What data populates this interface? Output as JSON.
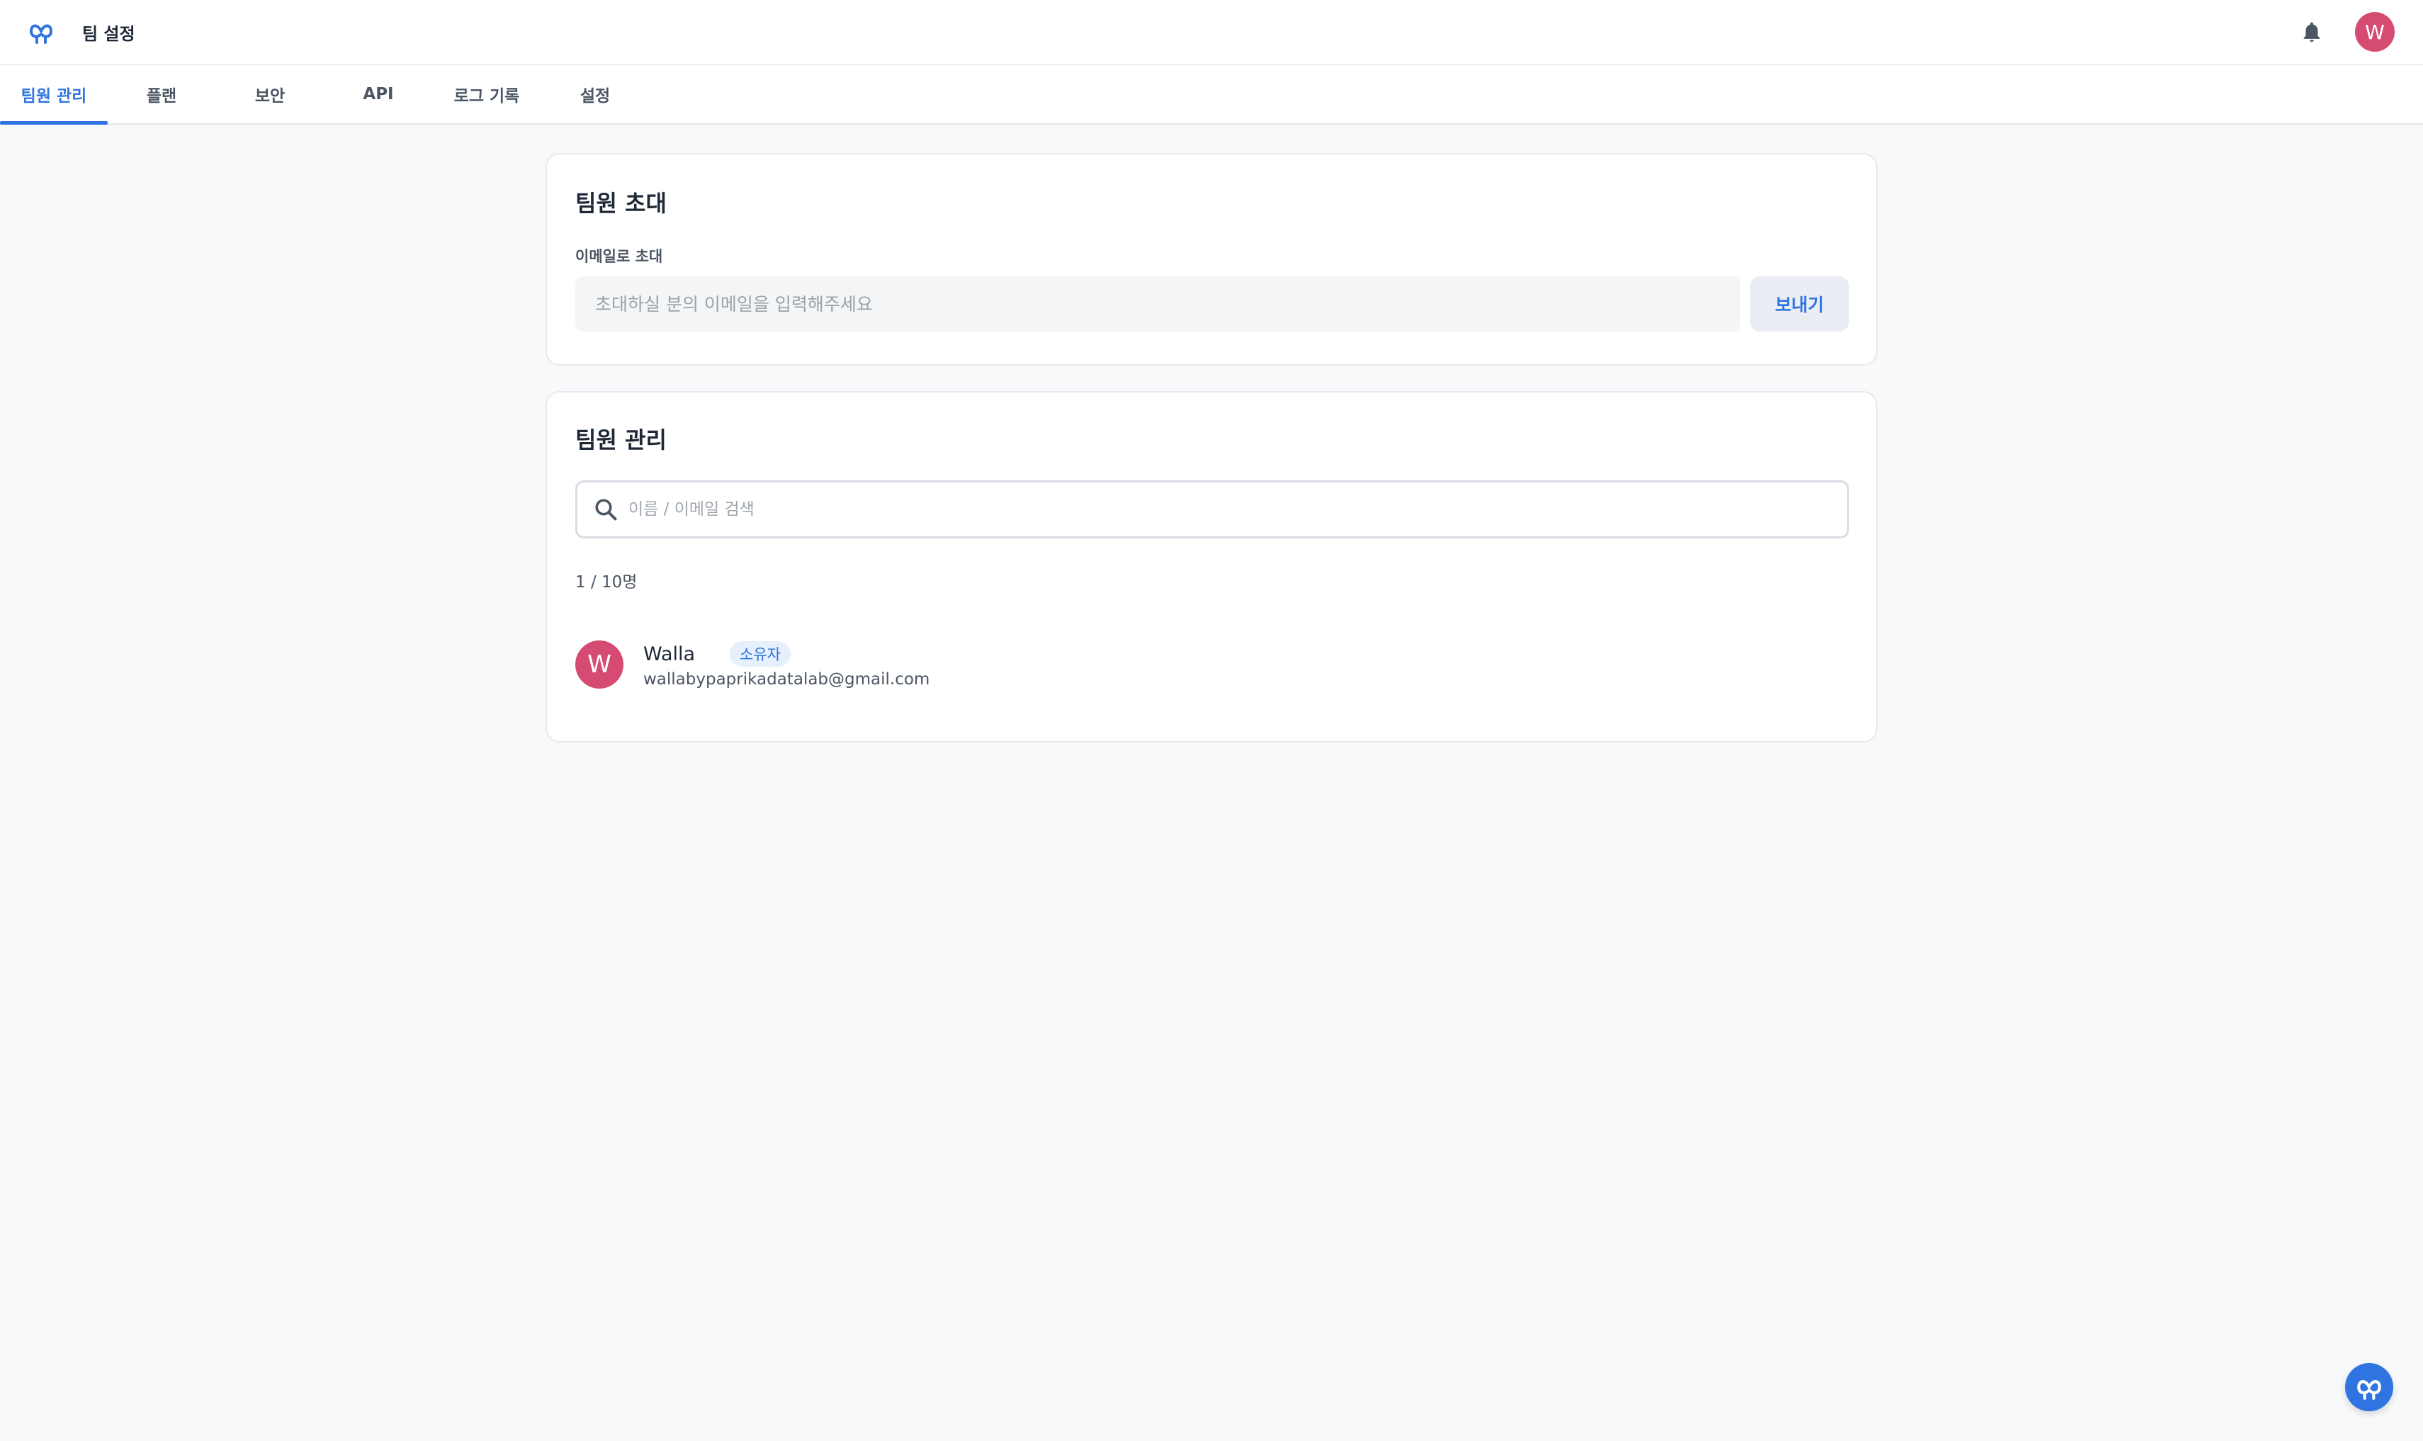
{
  "header": {
    "title": "팀 설정",
    "logo_icon": "infinity-logo-icon",
    "notification_icon": "bell-icon",
    "avatar_initial": "W"
  },
  "tabs": [
    {
      "label": "팀원 관리",
      "active": true
    },
    {
      "label": "플랜",
      "active": false
    },
    {
      "label": "보안",
      "active": false
    },
    {
      "label": "API",
      "active": false
    },
    {
      "label": "로그 기록",
      "active": false
    },
    {
      "label": "설정",
      "active": false
    }
  ],
  "invite_card": {
    "title": "팀원 초대",
    "field_label": "이메일로 초대",
    "input_placeholder": "초대하실 분의 이메일을 입력해주세요",
    "input_value": "",
    "send_label": "보내기"
  },
  "members_card": {
    "title": "팀원 관리",
    "search_placeholder": "이름 / 이메일 검색",
    "search_value": "",
    "count_text": "1 / 10명",
    "members": [
      {
        "initial": "W",
        "name": "Walla",
        "role": "소유자",
        "email": "wallabypaprikadatalab@gmail.com"
      }
    ]
  },
  "colors": {
    "accent": "#2f74e0",
    "avatar": "#d64b72",
    "background": "#f8f9fb"
  }
}
